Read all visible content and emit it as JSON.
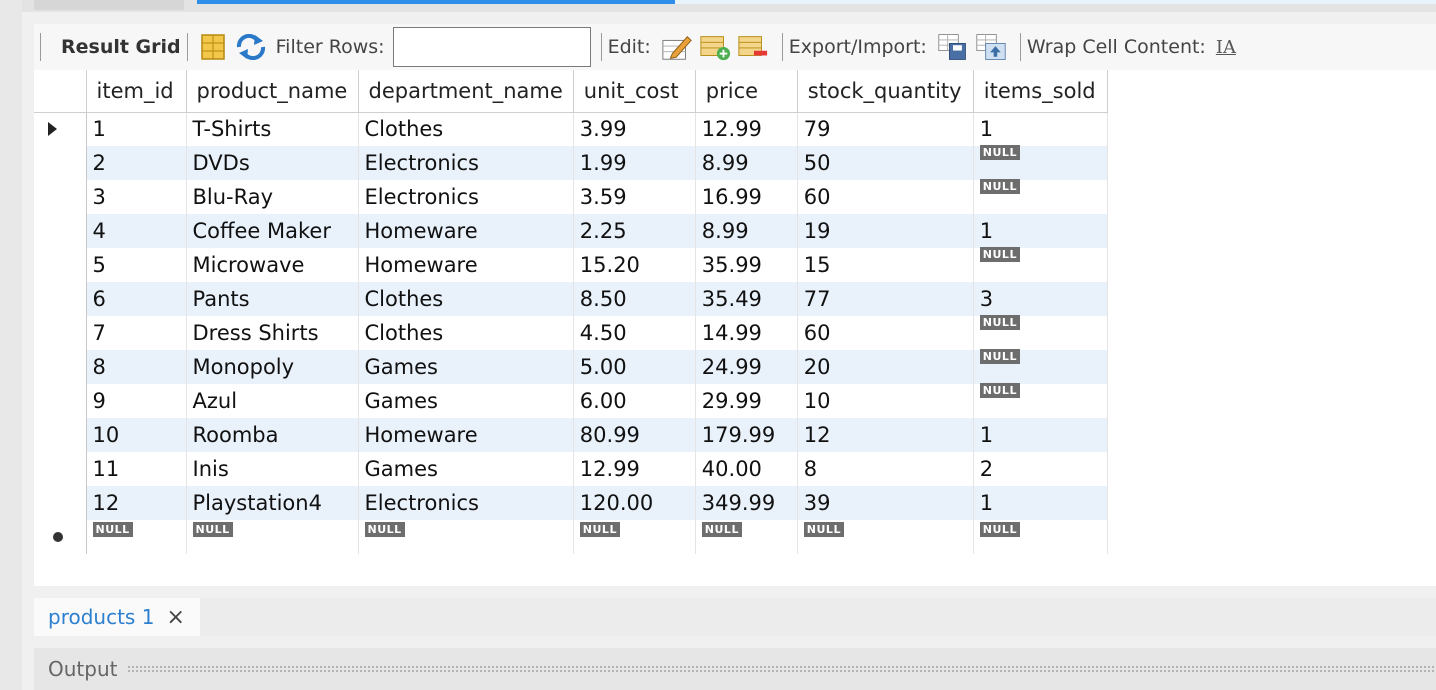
{
  "toolbar": {
    "result_grid_label": "Result Grid",
    "filter_rows_label": "Filter Rows:",
    "filter_value": "",
    "edit_label": "Edit:",
    "export_import_label": "Export/Import:",
    "wrap_label": "Wrap Cell Content:",
    "wrap_icon_text": "IA"
  },
  "grid": {
    "columns": [
      "item_id",
      "product_name",
      "department_name",
      "unit_cost",
      "price",
      "stock_quantity",
      "items_sold"
    ],
    "null_text": "NULL",
    "rows": [
      [
        "1",
        "T-Shirts",
        "Clothes",
        "3.99",
        "12.99",
        "79",
        "1"
      ],
      [
        "2",
        "DVDs",
        "Electronics",
        "1.99",
        "8.99",
        "50",
        "NULL"
      ],
      [
        "3",
        "Blu-Ray",
        "Electronics",
        "3.59",
        "16.99",
        "60",
        "NULL"
      ],
      [
        "4",
        "Coffee Maker",
        "Homeware",
        "2.25",
        "8.99",
        "19",
        "1"
      ],
      [
        "5",
        "Microwave",
        "Homeware",
        "15.20",
        "35.99",
        "15",
        "NULL"
      ],
      [
        "6",
        "Pants",
        "Clothes",
        "8.50",
        "35.49",
        "77",
        "3"
      ],
      [
        "7",
        "Dress Shirts",
        "Clothes",
        "4.50",
        "14.99",
        "60",
        "NULL"
      ],
      [
        "8",
        "Monopoly",
        "Games",
        "5.00",
        "24.99",
        "20",
        "NULL"
      ],
      [
        "9",
        "Azul",
        "Games",
        "6.00",
        "29.99",
        "10",
        "NULL"
      ],
      [
        "10",
        "Roomba",
        "Homeware",
        "80.99",
        "179.99",
        "12",
        "1"
      ],
      [
        "11",
        "Inis",
        "Games",
        "12.99",
        "40.00",
        "8",
        "2"
      ],
      [
        "12",
        "Playstation4",
        "Electronics",
        "120.00",
        "349.99",
        "39",
        "1"
      ]
    ]
  },
  "tabs": [
    {
      "label": "products 1",
      "close": "×"
    }
  ],
  "output": {
    "label": "Output"
  },
  "colors": {
    "accent": "#2d7fd0",
    "row_alt": "#e9f1fb",
    "null_badge": "#6d6d6d"
  }
}
